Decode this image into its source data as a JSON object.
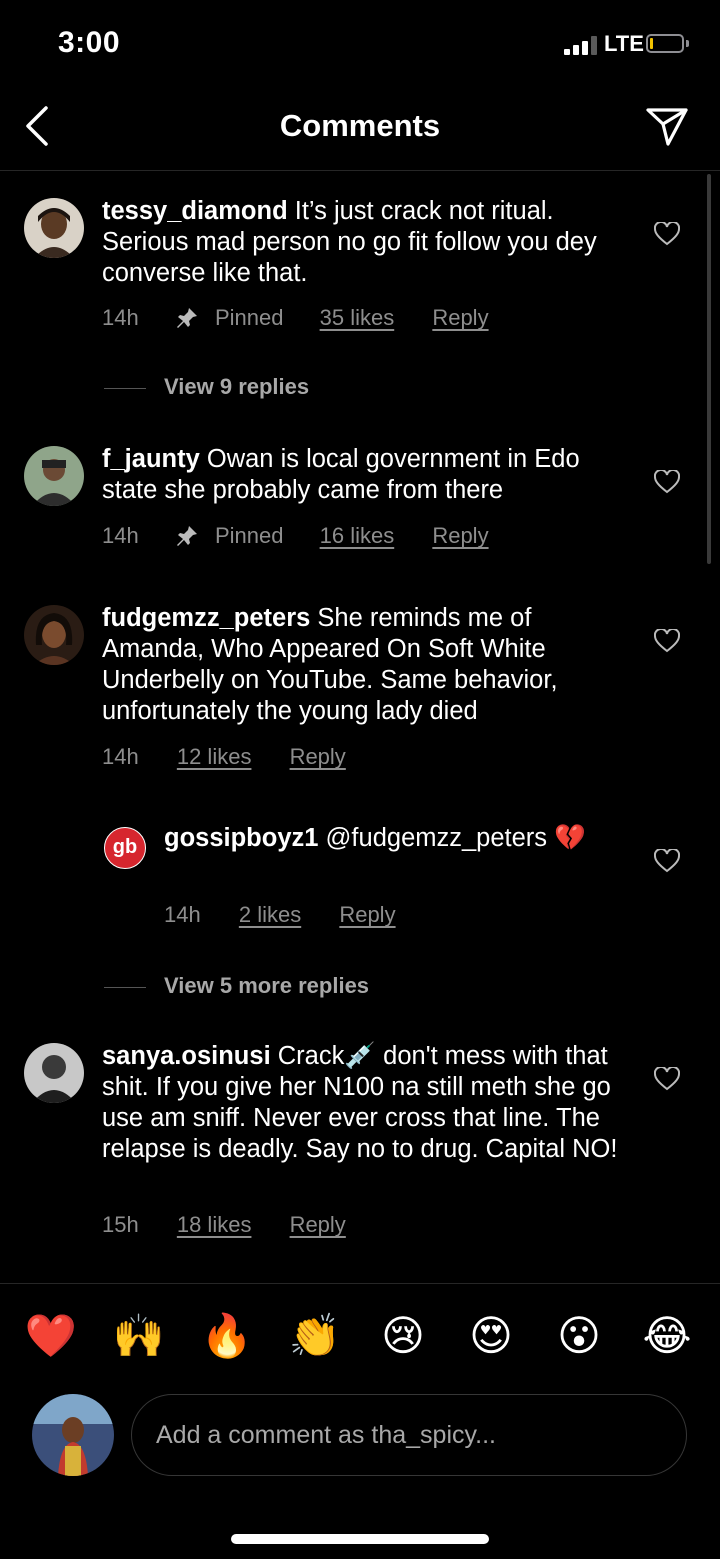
{
  "status_bar": {
    "time": "3:00",
    "network": "LTE"
  },
  "header": {
    "title": "Comments"
  },
  "comments": [
    {
      "user": "tessy_diamond",
      "text": "It’s  just crack not ritual. Serious mad person no go fit follow you dey converse like that.",
      "time": "14h",
      "pinned": "Pinned",
      "likes": "35 likes",
      "reply": "Reply",
      "view_replies": "View 9 replies"
    },
    {
      "user": "f_jaunty",
      "text": "Owan is local government in Edo state she probably came from there",
      "time": "14h",
      "pinned": "Pinned",
      "likes": "16 likes",
      "reply": "Reply"
    },
    {
      "user": "fudgemzz_peters",
      "text": "She reminds me of Amanda, Who Appeared On Soft White Underbelly on YouTube. Same behavior, unfortunately the young lady died",
      "time": "14h",
      "likes": "12 likes",
      "reply": "Reply",
      "sub_reply": {
        "avatar_text": "gb",
        "user": "gossipboyz1",
        "text": "@fudgemzz_peters 💔",
        "time": "14h",
        "likes": "2 likes",
        "reply": "Reply"
      },
      "view_replies": "View 5 more replies"
    },
    {
      "user": "sanya.osinusi",
      "text": "Crack💉 don't mess with that shit. If you give her N100 na still meth she go use am sniff. Never ever cross that line. The relapse is deadly. Say no to drug. Capital NO!",
      "time": "15h",
      "likes": "18 likes",
      "reply": "Reply"
    }
  ],
  "reactions": [
    "❤️",
    "🙌",
    "🔥",
    "👏",
    "😢",
    "😍",
    "😮",
    "😂"
  ],
  "composer": {
    "placeholder": "Add a comment as tha_spicy..."
  },
  "colors": {
    "background": "#000000",
    "secondary_text": "#8e8e8e",
    "divider": "#262626"
  }
}
